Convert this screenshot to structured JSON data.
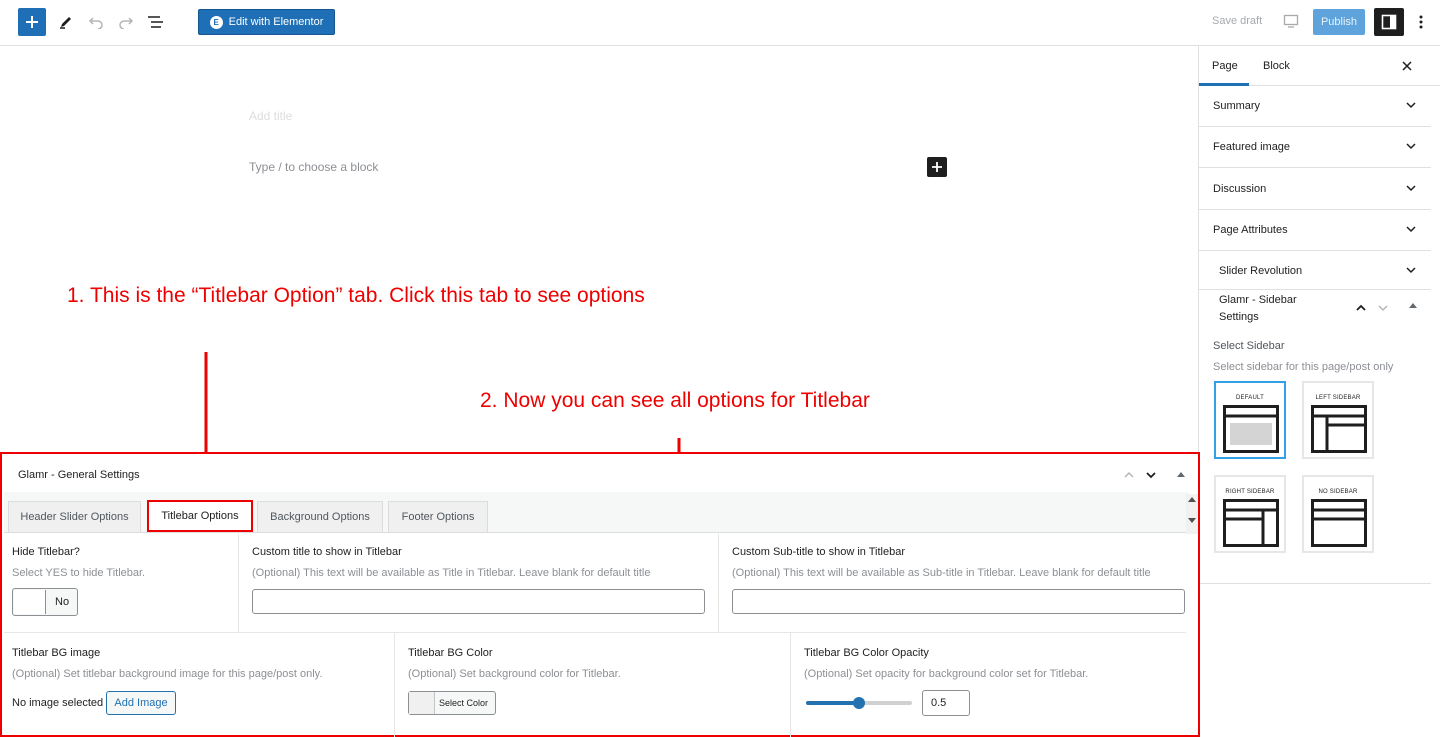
{
  "toolbar": {
    "elementor_label": "Edit with Elementor",
    "save_draft_label": "Save draft",
    "publish_label": "Publish"
  },
  "editor": {
    "title_placeholder": "Add title",
    "block_placeholder": "Type / to choose a block"
  },
  "annotations": {
    "step1": "1. This is the “Titlebar Option” tab. Click this tab to see options",
    "step2": "2. Now you can see all options for Titlebar"
  },
  "sidebar": {
    "tabs": [
      "Page",
      "Block"
    ],
    "active_tab": "Page",
    "panels": [
      "Summary",
      "Featured image",
      "Discussion",
      "Page Attributes",
      "Slider Revolution"
    ],
    "sidebar_settings": {
      "title": "Glamr - Sidebar Settings",
      "select_label": "Select Sidebar",
      "select_desc": "Select sidebar for this page/post only",
      "layouts": [
        "DEFAULT",
        "LEFT SIDEBAR",
        "RIGHT SIDEBAR",
        "NO SIDEBAR"
      ],
      "selected_layout": "DEFAULT"
    }
  },
  "metabox": {
    "title": "Glamr - General Settings",
    "tabs": [
      "Header Slider Options",
      "Titlebar Options",
      "Background Options",
      "Footer Options"
    ],
    "active_tab": "Titlebar Options",
    "fields": {
      "hide_titlebar": {
        "title": "Hide Titlebar?",
        "desc": "Select YES to hide Titlebar.",
        "value": "No"
      },
      "custom_title": {
        "title": "Custom title to show in Titlebar",
        "desc": "(Optional) This text will be available as Title in Titlebar. Leave blank for default title",
        "value": ""
      },
      "custom_subtitle": {
        "title": "Custom Sub-title to show in Titlebar",
        "desc": "(Optional) This text will be available as Sub-title in Titlebar. Leave blank for default title",
        "value": ""
      },
      "bg_image": {
        "title": "Titlebar BG image",
        "desc": "(Optional) Set titlebar background image for this page/post only.",
        "status": "No image selected",
        "button": "Add Image"
      },
      "bg_color": {
        "title": "Titlebar BG Color",
        "desc": "(Optional) Set background color for Titlebar.",
        "button": "Select Color"
      },
      "bg_opacity": {
        "title": "Titlebar BG Color Opacity",
        "desc": "(Optional) Set opacity for background color set for Titlebar.",
        "value": "0.5",
        "fraction": 0.5
      }
    }
  },
  "colors": {
    "accent": "#1e6fb5",
    "annotation": "#ee0000",
    "selected_layout_border": "#33a0e8"
  }
}
